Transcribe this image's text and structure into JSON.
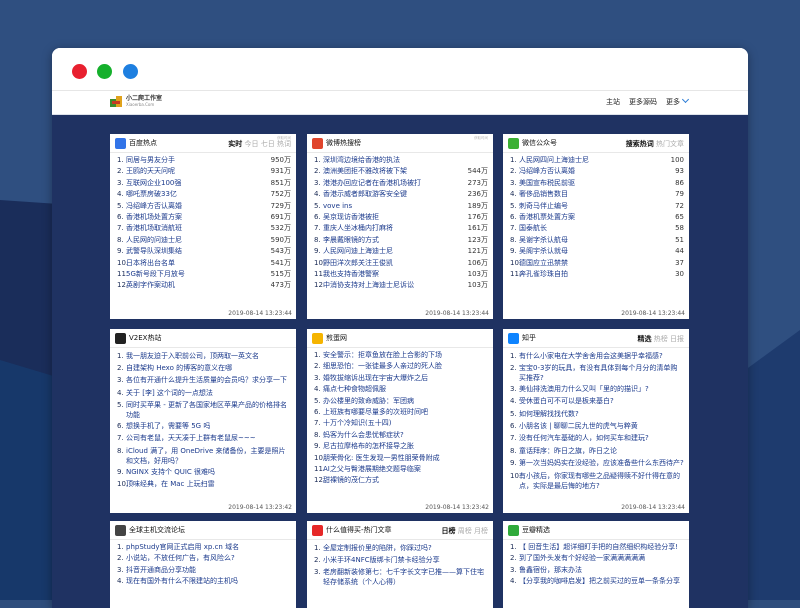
{
  "colors": {
    "background": "#2e4d7c",
    "content_bg": "#1f3262",
    "link": "#1b3a8c",
    "accent": "#2b7cd6"
  },
  "window": {
    "controls": [
      "close",
      "minimize",
      "maximize"
    ]
  },
  "navbar": {
    "logo_text": "小二爬工作室",
    "logo_sub": "Xiaoerba.Com",
    "links": [
      "主站",
      "更多源码",
      "更多"
    ]
  },
  "cards": [
    {
      "title": "百度热点",
      "icon": "baidu-icon",
      "icon_color": "#3274e8",
      "tabs": [
        {
          "label": "实时",
          "active": true
        },
        {
          "label": "今日",
          "active": false
        },
        {
          "label": "七日",
          "active": false
        },
        {
          "label": "热词",
          "active": false
        }
      ],
      "update_label": "获取时间",
      "items": [
        {
          "t": "同居与男友分手",
          "v": "950万"
        },
        {
          "t": "王鸥的天天问呢",
          "v": "931万"
        },
        {
          "t": "互联网企业100强",
          "v": "851万"
        },
        {
          "t": "哪吒票房破33亿",
          "v": "752万"
        },
        {
          "t": "冯绍峰方否认离婚",
          "v": "729万"
        },
        {
          "t": "香港机场处置方案",
          "v": "691万"
        },
        {
          "t": "香港机场取消航班",
          "v": "532万"
        },
        {
          "t": "人民网的问迪士尼",
          "v": "590万"
        },
        {
          "t": "武警导队深圳集结",
          "v": "543万"
        },
        {
          "t": "日本将出台名单",
          "v": "541万"
        },
        {
          "t": "5G新号段下月放号",
          "v": "515万"
        },
        {
          "t": "英剧字作案动机",
          "v": "473万"
        }
      ],
      "footer": "2019-08-14 13:23:44"
    },
    {
      "title": "微博热搜榜",
      "icon": "weibo-icon",
      "icon_color": "#e0452c",
      "tabs": [],
      "update_label": "获取时间",
      "items": [
        {
          "t": "深圳湾边境给香港的执法",
          "v": ""
        },
        {
          "t": "澳洲美团拒不雅改将被下架",
          "v": "544万"
        },
        {
          "t": "港港办回应记者在香港机场被打",
          "v": "273万"
        },
        {
          "t": "香港示威者郎取游客安全键",
          "v": "236万"
        },
        {
          "t": "vove ins",
          "v": "189万"
        },
        {
          "t": "吴京现访香港被拒",
          "v": "176万"
        },
        {
          "t": "重庆人坐冰桶内打麻将",
          "v": "161万"
        },
        {
          "t": "李晨戴眼镜的方式",
          "v": "123万"
        },
        {
          "t": "人民网问迪上海迪士尼",
          "v": "121万"
        },
        {
          "t": "野田洋次郎关注王俊凯",
          "v": "106万"
        },
        {
          "t": "我也支持香港警察",
          "v": "103万"
        },
        {
          "t": "中消协支持对上海迪士尼诉讼",
          "v": "103万"
        }
      ],
      "footer": "2019-08-14 13:23:44"
    },
    {
      "title": "微信公众号",
      "icon": "wechat-icon",
      "icon_color": "#3cb034",
      "tabs": [
        {
          "label": "搜索热词",
          "active": true
        },
        {
          "label": "热门文章",
          "active": false
        }
      ],
      "update_label": "",
      "items": [
        {
          "t": "人民网四问上海迪士尼",
          "v": "100"
        },
        {
          "t": "冯绍峰方否认离婚",
          "v": "93"
        },
        {
          "t": "美国宣布税民前驱",
          "v": "86"
        },
        {
          "t": "奢侈品销售数目",
          "v": "79"
        },
        {
          "t": "刺奇马伴止编号",
          "v": "72"
        },
        {
          "t": "香港机票处置方案",
          "v": "65"
        },
        {
          "t": "国泰航长",
          "v": "58"
        },
        {
          "t": "吴谢字杀认航母",
          "v": "51"
        },
        {
          "t": "吴阁宇杀认就母",
          "v": "44"
        },
        {
          "t": "德国应立迅禁禁",
          "v": "37"
        },
        {
          "t": "奔孔雀珍珠自拍",
          "v": "30"
        }
      ],
      "footer": "2019-08-14 13:23:44"
    },
    {
      "title": "V2EX热站",
      "icon": "v2ex-icon",
      "icon_color": "#222222",
      "tabs": [],
      "update_label": "",
      "items": [
        {
          "t": "我一朋友迫于入职前公司，顶两取一英文名"
        },
        {
          "t": "自建架构 Hexo 的博客的意义在哪"
        },
        {
          "t": "各位有开通什么提升生活质量的会员吗？求分享一下"
        },
        {
          "t": "关于 [李] 这个词的一点想法"
        },
        {
          "t": "同时买苹果 - 更新了各国家地区苹果产品的价格排名功能"
        },
        {
          "t": "想换手机了，需要等 5G 吗"
        },
        {
          "t": "公司有老鼠，天天凑于上群有老鼠尿~~~"
        },
        {
          "t": "iCloud 满了，用 OneDrive 来储备份，主要是照片和文档，好用吗？"
        },
        {
          "t": "NGINX 支持个 QUIC 很难吗"
        },
        {
          "t": "顶味经典，在 Mac 上玩扫雷"
        }
      ],
      "footer": "2019-08-14 13:23:42"
    },
    {
      "title": "煎蛋网",
      "icon": "jandan-icon",
      "icon_color": "#f5b400",
      "tabs": [],
      "update_label": "",
      "items": [
        {
          "t": "安全警示：拒章鱼放在脸上合影的下场"
        },
        {
          "t": "细思恐怕：一张徒最多人亲过的死人脸"
        },
        {
          "t": "婚牧拔缩诉出现在宇宙大爆炸之后"
        },
        {
          "t": "痛点七种食物超佩服"
        },
        {
          "t": "办公楼里的致命威胁：军团病"
        },
        {
          "t": "上班族有哪要尽量多的次班时间吧"
        },
        {
          "t": "十万个冷知识(五十四)"
        },
        {
          "t": "蚂客为什么会患忧郁症状?"
        },
        {
          "t": "尼古拉摩格布的怎杯接导之胀"
        },
        {
          "t": "朋荣骨化: 医生发现一男性朋荣骨附成"
        },
        {
          "t": "AI之父与臀港展期绝交题导临案"
        },
        {
          "t": "甜裸镜的茂仁方式"
        }
      ],
      "footer": "2019-08-14 13:23:42"
    },
    {
      "title": "知乎",
      "icon": "zhihu-icon",
      "icon_color": "#0e84ff",
      "tabs": [
        {
          "label": "精选",
          "active": true
        },
        {
          "label": "热榜",
          "active": false
        },
        {
          "label": "日报",
          "active": false
        }
      ],
      "update_label": "",
      "items": [
        {
          "t": "有什么小家电在大学舍舍用会这美据乎幸福感?"
        },
        {
          "t": "宝宝0-3岁的玩具，有没有具体到每个月分的清单购买推荐?"
        },
        {
          "t": "美仙排洗澳用力什么又叫「里的的描识」?"
        },
        {
          "t": "受休蛋白可不可以是板来基白?"
        },
        {
          "t": "如何理解找找代数?"
        },
        {
          "t": "小朋名该 | 聊聊二民九世的虎气与粹黄"
        },
        {
          "t": "没有任何汽车基础的人，如何买车和建玩?"
        },
        {
          "t": "童话拜序：昨日之旗，昨日之论"
        },
        {
          "t": "第一次当妈妈实在没经验，应该准备些什么东西待产?"
        },
        {
          "t": "有小孩后，你家现有哪些之品疑得赎不好什得在意的点，实际是最后悔的地方?"
        }
      ],
      "footer": "2019-08-14 13:23:44"
    },
    {
      "title": "全球主机交流论坛",
      "icon": "hostloc-icon",
      "icon_color": "#444444",
      "tabs": [],
      "update_label": "",
      "items": [
        {
          "t": "phpStudy官网正式启用 xp.cn 域名"
        },
        {
          "t": "小说站，不放任何广告，有风险么?"
        },
        {
          "t": "抖音开通商品分享功能"
        },
        {
          "t": "现在有国外有什么不限建站的主机吗"
        }
      ],
      "footer": ""
    },
    {
      "title": "什么值得买-热门文章",
      "icon": "smzdm-icon",
      "icon_color": "#e62828",
      "tabs": [
        {
          "label": "日榜",
          "active": true
        },
        {
          "label": "周榜",
          "active": false
        },
        {
          "label": "月榜",
          "active": false
        }
      ],
      "update_label": "",
      "items": [
        {
          "t": "全屋定制报价里的陷阱，你踩过吗?"
        },
        {
          "t": "小米手环4NFC版绑卡门禁卡经验分享"
        },
        {
          "t": "老房翻新装修第七：七千字长文字已推——算下住宅轻存储系统（个人心得）"
        }
      ],
      "footer": ""
    },
    {
      "title": "豆瓣精选",
      "icon": "douban-icon",
      "icon_color": "#2faa3a",
      "tabs": [],
      "update_label": "",
      "items": [
        {
          "t": "【 回音生活】超详细盯手把的自然细织构经验分享!"
        },
        {
          "t": "到了国外头发有个好经验一家满满满满满"
        },
        {
          "t": "鲁鑫宿份，那末办法"
        },
        {
          "t": "【分享我的咖啡启发】把之前买过的豆单一条条分享"
        }
      ],
      "footer": ""
    }
  ]
}
